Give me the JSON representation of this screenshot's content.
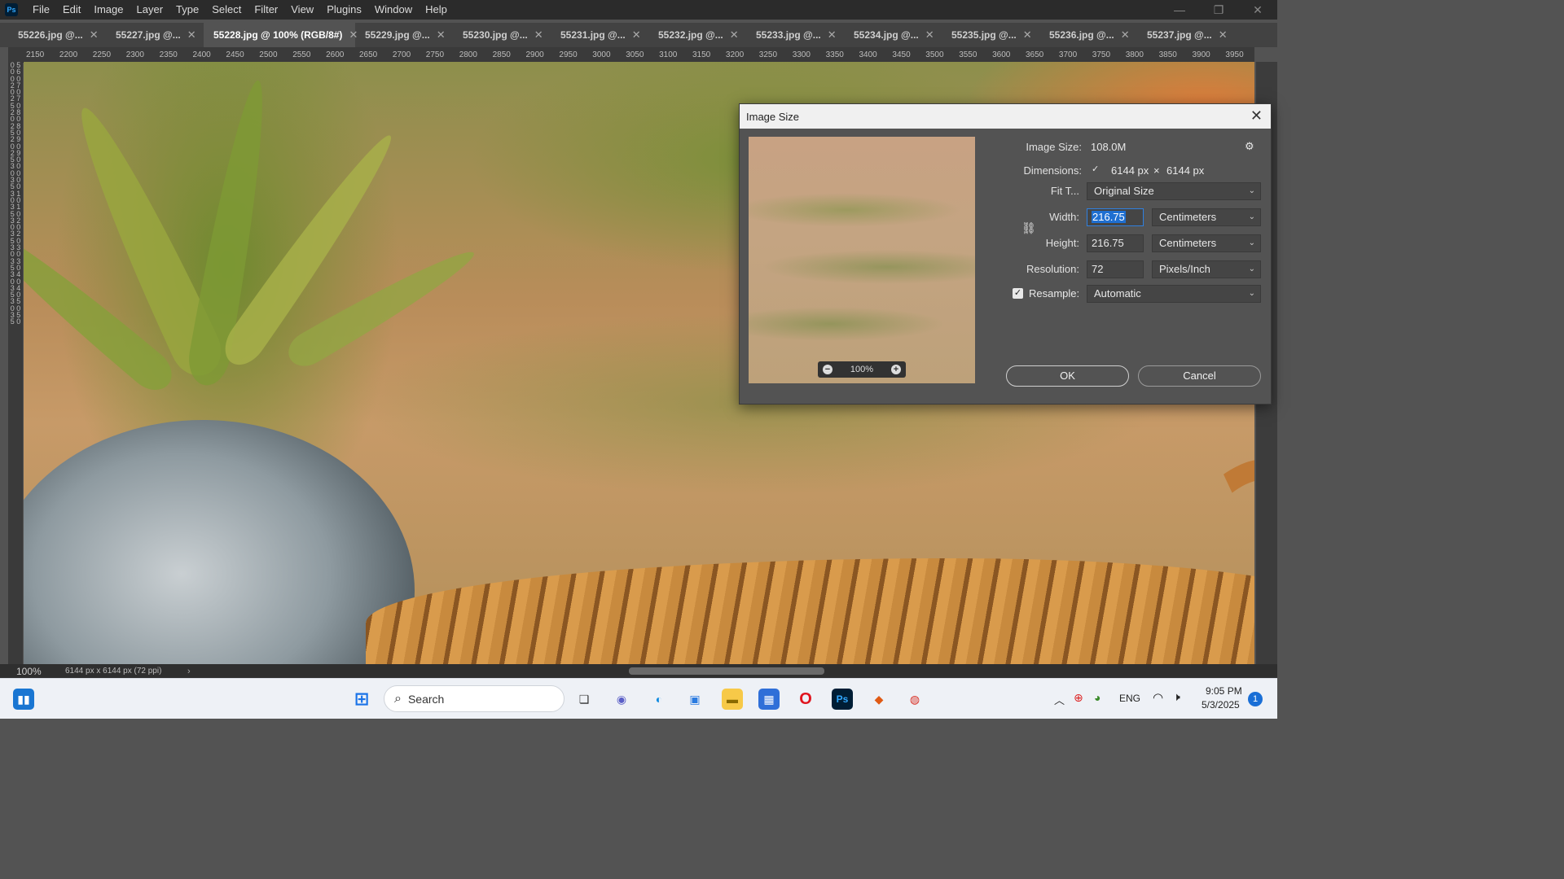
{
  "app": {
    "logo": "Ps",
    "menu": [
      "File",
      "Edit",
      "Image",
      "Layer",
      "Type",
      "Select",
      "Filter",
      "View",
      "Plugins",
      "Window",
      "Help"
    ]
  },
  "tabs": [
    {
      "label": "55226.jpg @...",
      "active": false
    },
    {
      "label": "55227.jpg @...",
      "active": false
    },
    {
      "label": "55228.jpg @ 100% (RGB/8#)",
      "active": true
    },
    {
      "label": "55229.jpg @...",
      "active": false
    },
    {
      "label": "55230.jpg @...",
      "active": false
    },
    {
      "label": "55231.jpg @...",
      "active": false
    },
    {
      "label": "55232.jpg @...",
      "active": false
    },
    {
      "label": "55233.jpg @...",
      "active": false
    },
    {
      "label": "55234.jpg @...",
      "active": false
    },
    {
      "label": "55235.jpg @...",
      "active": false
    },
    {
      "label": "55236.jpg @...",
      "active": false
    },
    {
      "label": "55237.jpg @...",
      "active": false
    }
  ],
  "ruler": {
    "top_ticks": [
      "2150",
      "2200",
      "2250",
      "2300",
      "2350",
      "2400",
      "2450",
      "2500",
      "2550",
      "2600",
      "2650",
      "2700",
      "2750",
      "2800",
      "2850",
      "2900",
      "2950",
      "3000",
      "3050",
      "3100",
      "3150",
      "3200",
      "3250",
      "3300",
      "3350",
      "3400",
      "3450",
      "3500",
      "3550",
      "3600",
      "3650",
      "3700",
      "3750",
      "3800",
      "3850",
      "3900",
      "3950"
    ],
    "left_text": "0 5 0 6 0 0 2 7 0 0 2 7 5 0 2 8 0 0 2 8 5 0 2 9 0 0 2 9 5 0 3 0 0 0 3 0 5 0 3 1 0 0 3 1 5 0 3 2 0 0 3 2 5 0 3 3 0 0 3 3 5 0 3 4 0 0 3 4 5 0 3 5 0 0 3 5 5 0"
  },
  "status": {
    "zoom": "100%",
    "doc_info": "6144 px x 6144 px (72 ppi)",
    "arrow": "›"
  },
  "dialog": {
    "title": "Image Size",
    "close": "✕",
    "image_size_label": "Image Size:",
    "image_size_value": "108.0M",
    "dimensions_label": "Dimensions:",
    "dim_w": "6144 px",
    "dim_x": "×",
    "dim_h": "6144 px",
    "fit_label": "Fit T...",
    "fit_value": "Original Size",
    "width_label": "Width:",
    "width_value": "216.75",
    "width_unit": "Centimeters",
    "height_label": "Height:",
    "height_value": "216.75",
    "height_unit": "Centimeters",
    "resolution_label": "Resolution:",
    "resolution_value": "72",
    "resolution_unit": "Pixels/Inch",
    "resample_label": "Resample:",
    "resample_checked": true,
    "resample_value": "Automatic",
    "preview_zoom": "100%",
    "ok": "OK",
    "cancel": "Cancel"
  },
  "taskbar": {
    "search_placeholder": "Search",
    "language": "ENG",
    "time": "9:05 PM",
    "date": "5/3/2025",
    "notification_count": "1"
  }
}
